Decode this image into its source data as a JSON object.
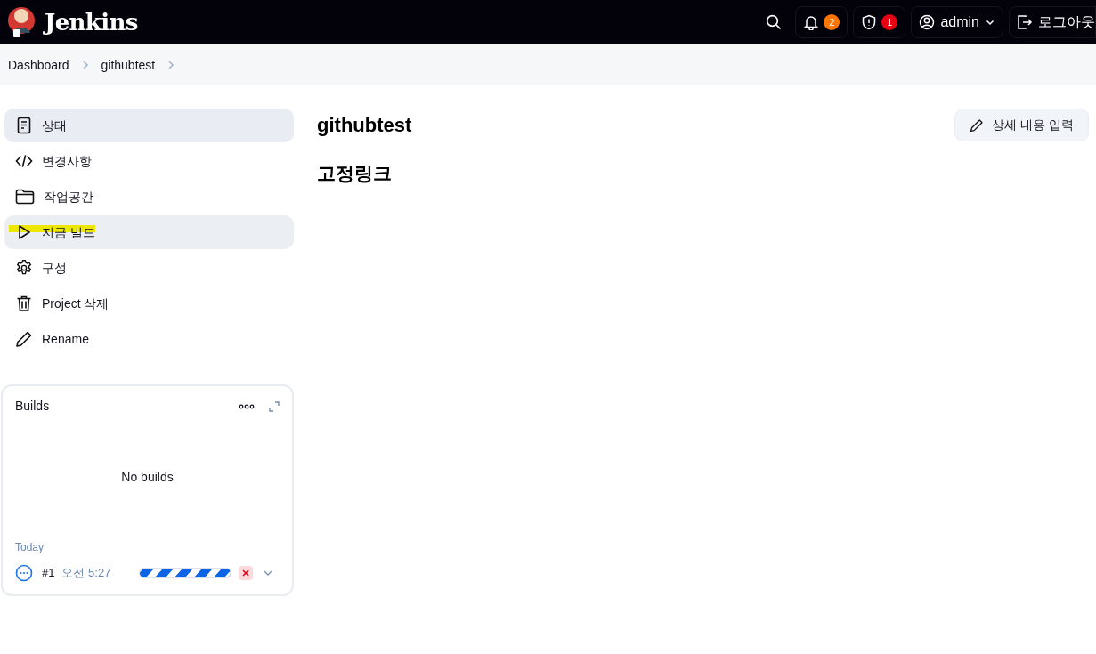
{
  "header": {
    "title": "Jenkins",
    "notifications": "2",
    "security": "1",
    "user": "admin",
    "logout": "로그아웃"
  },
  "breadcrumbs": [
    "Dashboard",
    "githubtest"
  ],
  "sidebar": {
    "items": [
      {
        "label": "상태",
        "kind": "notepad",
        "selected": true,
        "hovered": false,
        "highlighted": false
      },
      {
        "label": "변경사항",
        "kind": "code",
        "selected": false,
        "hovered": false,
        "highlighted": false
      },
      {
        "label": "작업공간",
        "kind": "folder",
        "selected": false,
        "hovered": false,
        "highlighted": false
      },
      {
        "label": "지금 빌드",
        "kind": "play",
        "selected": false,
        "hovered": true,
        "highlighted": true
      },
      {
        "label": "구성",
        "kind": "gear",
        "selected": false,
        "hovered": false,
        "highlighted": false
      },
      {
        "label": "Project 삭제",
        "kind": "trash",
        "selected": false,
        "hovered": false,
        "highlighted": false
      },
      {
        "label": "Rename",
        "kind": "pencil",
        "selected": false,
        "hovered": false,
        "highlighted": false
      }
    ]
  },
  "builds": {
    "title": "Builds",
    "empty": "No builds",
    "group": "Today",
    "rows": [
      {
        "number": "#1",
        "time": "오전 5:27",
        "indeterminate": true
      }
    ]
  },
  "main": {
    "title": "githubtest",
    "edit_button": "상세 내용 입력",
    "section": "고정링크"
  }
}
